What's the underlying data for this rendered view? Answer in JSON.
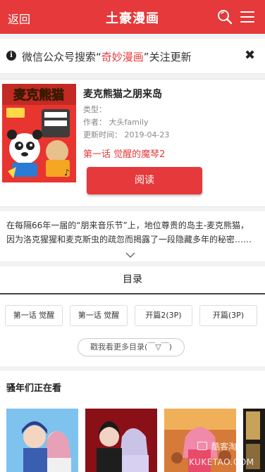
{
  "header": {
    "back_label": "返回",
    "logo_text": "土豪漫画"
  },
  "notice": {
    "prefix": "微信公众号搜索“",
    "highlight": "奇妙漫画",
    "suffix": "”关注更新",
    "close_symbol": "✖"
  },
  "book": {
    "cover_title_art": "麦克熊猫",
    "title": "麦克熊猫之朋来岛",
    "type_label": "类型：",
    "author_label": "作者：",
    "author": "大头family",
    "updated_label": "更新时间：",
    "updated": "2019-04-23",
    "latest_chapter": "第一话 觉醒的魔琴2",
    "read_label": "阅读"
  },
  "description": {
    "text": "在每隔66年一届的“朋来音乐节”上，地位尊贵的岛主-麦克熊猫，因为洛克猩猩和麦克斯虫的疏忽而揭露了一段隐藏多年的秘密……"
  },
  "catalog": {
    "heading": "目录",
    "chapters": [
      "第一话 觉醒",
      "第一话 觉醒",
      "开篇2(3P)",
      "开篇(3P)"
    ],
    "more_label": "戳我看更多目录(￣▽￣)"
  },
  "watching": {
    "heading": "骚年们正在看"
  },
  "watermark": {
    "name": "酷客淘",
    "domain": "KUKETAO.COM"
  },
  "colors": {
    "brand": "#e5393b"
  },
  "icons": {
    "search": "search-icon",
    "menu": "menu-icon",
    "info": "info-icon",
    "close": "close-icon",
    "chevron": "chevron-down-icon"
  }
}
